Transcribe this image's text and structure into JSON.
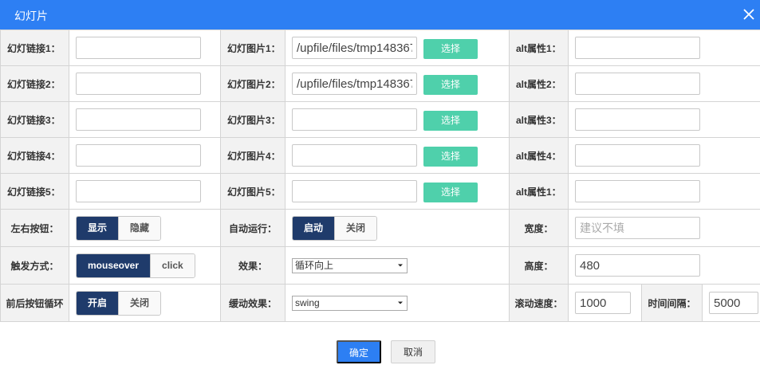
{
  "dialog": {
    "title": "幻灯片",
    "close_icon": "close-icon"
  },
  "rows": [
    {
      "link_label": "幻灯链接1：",
      "link_value": "",
      "image_label": "幻灯图片1：",
      "image_value": "/upfile/files/tmp1483676",
      "alt_label": "alt属性1：",
      "alt_value": ""
    },
    {
      "link_label": "幻灯链接2：",
      "link_value": "",
      "image_label": "幻灯图片2：",
      "image_value": "/upfile/files/tmp1483676",
      "alt_label": "alt属性2：",
      "alt_value": ""
    },
    {
      "link_label": "幻灯链接3：",
      "link_value": "",
      "image_label": "幻灯图片3：",
      "image_value": "",
      "alt_label": "alt属性3：",
      "alt_value": ""
    },
    {
      "link_label": "幻灯链接4：",
      "link_value": "",
      "image_label": "幻灯图片4：",
      "image_value": "",
      "alt_label": "alt属性4：",
      "alt_value": ""
    },
    {
      "link_label": "幻灯链接5：",
      "link_value": "",
      "image_label": "幻灯图片5：",
      "image_value": "",
      "alt_label": "alt属性1：",
      "alt_value": ""
    }
  ],
  "choose_label": "选择",
  "arrows": {
    "label": "左右按钮：",
    "options": [
      "显示",
      "隐藏"
    ],
    "selected": "显示"
  },
  "autoplay": {
    "label": "自动运行：",
    "options": [
      "启动",
      "关闭"
    ],
    "selected": "启动"
  },
  "width": {
    "label": "宽度：",
    "value": "",
    "placeholder": "建议不填"
  },
  "trigger": {
    "label": "触发方式：",
    "options": [
      "mouseover",
      "click"
    ],
    "selected": "mouseover"
  },
  "effect": {
    "label": "效果：",
    "value": "循环向上"
  },
  "height": {
    "label": "高度：",
    "value": "480"
  },
  "loop": {
    "label": "前后按钮循环",
    "options": [
      "开启",
      "关闭"
    ],
    "selected": "开启"
  },
  "easing": {
    "label": "缓动效果：",
    "value": "swing"
  },
  "scroll_speed": {
    "label": "滚动速度：",
    "value": "1000"
  },
  "interval": {
    "label": "时间间隔：",
    "value": "5000"
  },
  "footer": {
    "ok_label": "确定",
    "cancel_label": "取消"
  },
  "colors": {
    "titlebar": "#2d7ff3",
    "choose_button": "#4fd0ab",
    "segment_active": "#1f3b6b",
    "ok_button": "#2d7ff3"
  }
}
